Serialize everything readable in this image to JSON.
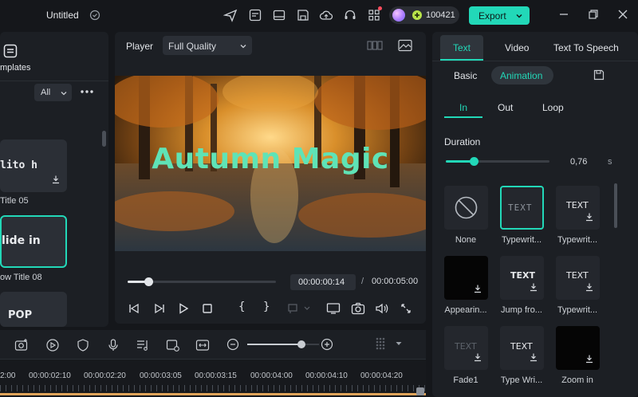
{
  "window": {
    "title": "Untitled"
  },
  "credits": {
    "value": "100421"
  },
  "export": {
    "label": "Export"
  },
  "left": {
    "templates_label": "mplates",
    "filter": "All",
    "cards": [
      {
        "preview": "lito h",
        "label": "Title 05"
      },
      {
        "preview": "lide in",
        "label": "ow Title 08"
      },
      {
        "preview": "POP",
        "label": ""
      }
    ]
  },
  "player": {
    "label": "Player",
    "quality": "Full Quality",
    "overlay_text": "Autumn Magic",
    "current_time": "00:00:00:14",
    "separator": "/",
    "total_time": "00:00:05:00",
    "progress": 0.14
  },
  "right": {
    "tabs": [
      "Text",
      "Video",
      "Text To Speech"
    ],
    "subtabs": [
      "Basic",
      "Animation"
    ],
    "anim_tabs": [
      "In",
      "Out",
      "Loop"
    ],
    "duration_label": "Duration",
    "duration_value": "0,76",
    "duration_unit": "s",
    "duration_level": 0.27,
    "presets": [
      {
        "name": "None",
        "preview": ""
      },
      {
        "name": "Typewrit...",
        "preview": "TEXT"
      },
      {
        "name": "Typewrit...",
        "preview": "TEXT"
      },
      {
        "name": "Appearin...",
        "preview": ""
      },
      {
        "name": "Jump fro...",
        "preview": "TEXT"
      },
      {
        "name": "Typewrit...",
        "preview": "TEXT"
      },
      {
        "name": "Fade1",
        "preview": "TEXT"
      },
      {
        "name": "Type Wri...",
        "preview": "TEXT"
      },
      {
        "name": "Zoom in",
        "preview": ""
      }
    ]
  },
  "timeline": {
    "ticks": [
      "2:00",
      "00:00:02:10",
      "00:00:02:20",
      "00:00:03:05",
      "00:00:03:15",
      "00:00:04:00",
      "00:00:04:10",
      "00:00:04:20"
    ],
    "zoom_level": 0.75
  },
  "colors": {
    "accent": "#22d8b8",
    "panel": "#1c1f24",
    "background": "#15171b"
  }
}
